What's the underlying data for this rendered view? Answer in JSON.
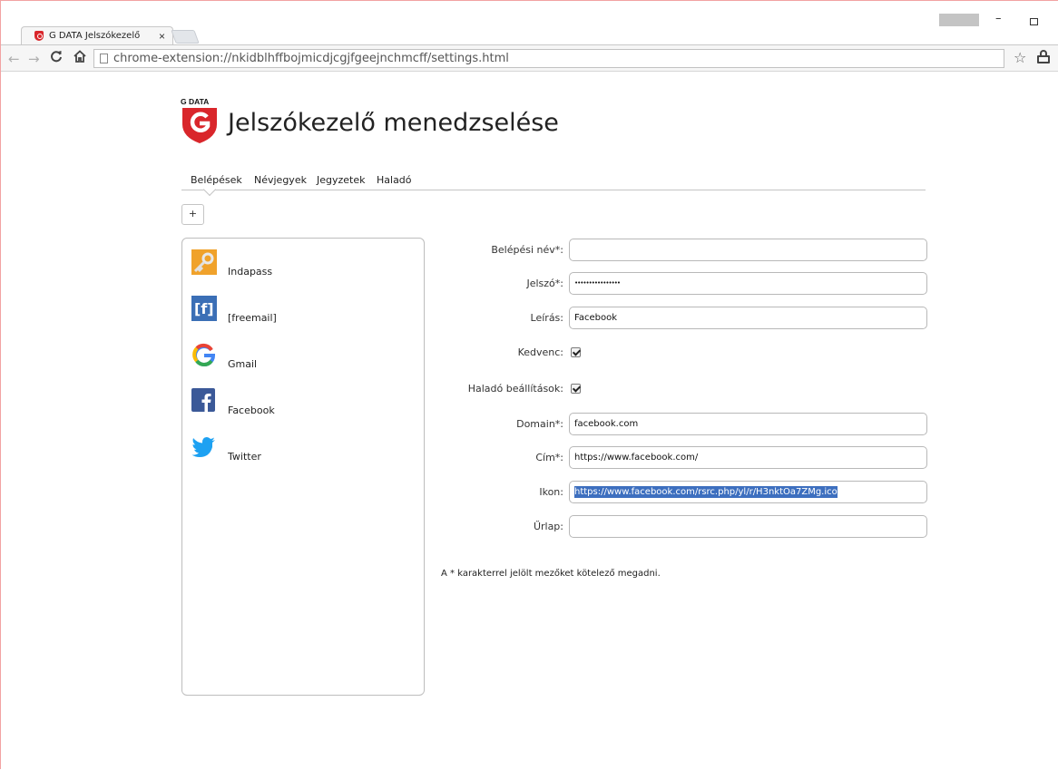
{
  "browser": {
    "tab_title": "G DATA Jelszókezelő",
    "tab_close": "×",
    "url": "chrome-extension://nkidblhffbojmicdjcgjfgeejnchmcff/settings.html",
    "back": "←",
    "forward": "→",
    "reload": "C",
    "home": "⌂",
    "star": "☆",
    "minimize": "–"
  },
  "header": {
    "logo_text": "G DATA",
    "title": "Jelszókezelő menedzselése"
  },
  "tabs": [
    {
      "label": "Belépések",
      "active": true
    },
    {
      "label": "Névjegyek",
      "active": false
    },
    {
      "label": "Jegyzetek",
      "active": false
    },
    {
      "label": "Haladó",
      "active": false
    }
  ],
  "add_button": "+",
  "logins": [
    {
      "label": "Indapass",
      "icon": "key-icon"
    },
    {
      "label": "[freemail]",
      "icon": "freemail-icon"
    },
    {
      "label": "Gmail",
      "icon": "google-icon"
    },
    {
      "label": "Facebook",
      "icon": "facebook-icon"
    },
    {
      "label": "Twitter",
      "icon": "twitter-icon"
    }
  ],
  "form": {
    "username_label": "Belépési név*:",
    "username_value": "",
    "password_label": "Jelszó*:",
    "password_value": "••••••••••••••••",
    "description_label": "Leírás:",
    "description_value": "Facebook",
    "favorite_label": "Kedvenc:",
    "favorite_checked": true,
    "advanced_label": "Haladó beállítások:",
    "advanced_checked": true,
    "domain_label": "Domain*:",
    "domain_value": "facebook.com",
    "address_label": "Cím*:",
    "address_value": "https://www.facebook.com/",
    "icon_label": "Ikon:",
    "icon_value": "https://www.facebook.com/rsrc.php/yl/r/H3nktOa7ZMg.ico",
    "form_label": "Űrlap:",
    "form_value": ""
  },
  "footnote": "A * karakterrel jelölt mezőket kötelező megadni.",
  "colors": {
    "gdata_red": "#d9262b",
    "facebook_blue": "#3b5998",
    "twitter_blue": "#1da1f2",
    "selection_blue": "#3d6fbf"
  }
}
